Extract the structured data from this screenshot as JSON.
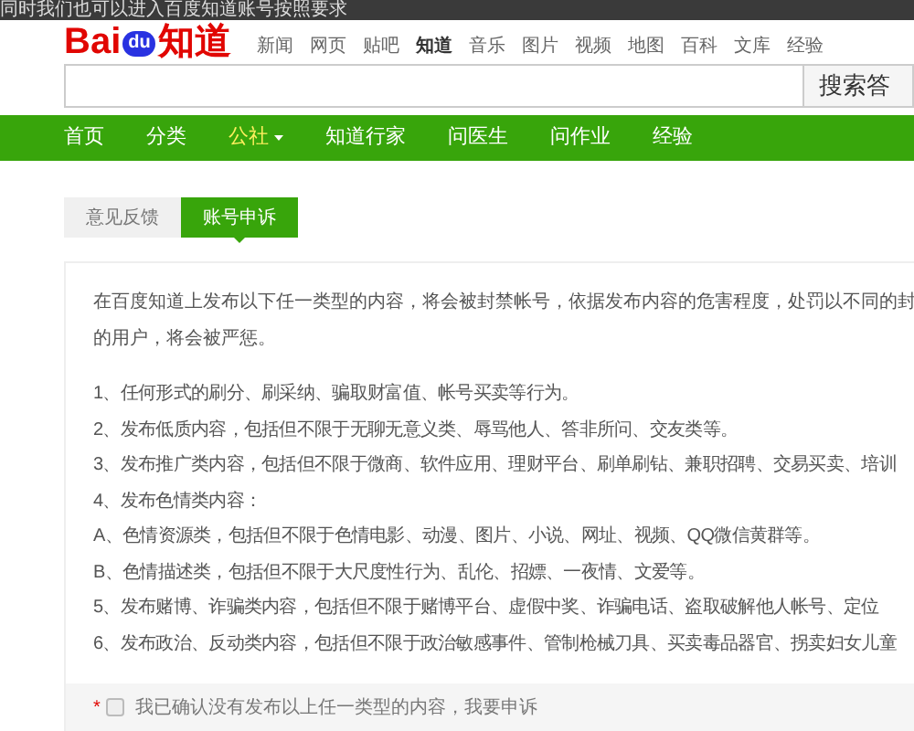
{
  "top_caption": "同时我们也可以进入百度知道账号按照要求",
  "logo": {
    "text_left": "Bai",
    "text_paw": "du",
    "text_right": "知道"
  },
  "product_links": [
    {
      "label": "新闻",
      "selected": false
    },
    {
      "label": "网页",
      "selected": false
    },
    {
      "label": "贴吧",
      "selected": false
    },
    {
      "label": "知道",
      "selected": true
    },
    {
      "label": "音乐",
      "selected": false
    },
    {
      "label": "图片",
      "selected": false
    },
    {
      "label": "视频",
      "selected": false
    },
    {
      "label": "地图",
      "selected": false
    },
    {
      "label": "百科",
      "selected": false
    },
    {
      "label": "文库",
      "selected": false
    },
    {
      "label": "经验",
      "selected": false
    }
  ],
  "search": {
    "button": "搜索答"
  },
  "nav": [
    {
      "label": "首页",
      "selected": false,
      "dropdown": false
    },
    {
      "label": "分类",
      "selected": false,
      "dropdown": false
    },
    {
      "label": "公社",
      "selected": true,
      "dropdown": true
    },
    {
      "label": "知道行家",
      "selected": false,
      "dropdown": false
    },
    {
      "label": "问医生",
      "selected": false,
      "dropdown": false
    },
    {
      "label": "问作业",
      "selected": false,
      "dropdown": false
    },
    {
      "label": "经验",
      "selected": false,
      "dropdown": false
    }
  ],
  "tabs": [
    {
      "label": "意见反馈",
      "selected": false
    },
    {
      "label": "账号申诉",
      "selected": true
    }
  ],
  "intro": [
    "在百度知道上发布以下任一类型的内容，将会被封禁帐号，依据发布内容的危害程度，处罚以不同的封",
    "的用户，将会被严惩。"
  ],
  "rules": [
    "1、任何形式的刷分、刷采纳、骗取财富值、帐号买卖等行为。",
    "2、发布低质内容，包括但不限于无聊无意义类、辱骂他人、答非所问、交友类等。",
    "3、发布推广类内容，包括但不限于微商、软件应用、理财平台、刷单刷钻、兼职招聘、交易买卖、培训",
    "4、发布色情类内容：",
    "A、色情资源类，包括但不限于色情电影、动漫、图片、小说、网址、视频、QQ微信黄群等。",
    "B、色情描述类，包括但不限于大尺度性行为、乱伦、招嫖、一夜情、文爱等。",
    "5、发布赌博、诈骗类内容，包括但不限于赌博平台、虚假中奖、诈骗电话、盗取破解他人帐号、定位",
    "6、发布政治、反动类内容，包括但不限于政治敏感事件、管制枪械刀具、买卖毒品器官、拐卖妇女儿童"
  ],
  "confirm": {
    "required_mark": "*",
    "label": "我已确认没有发布以上任一类型的内容，我要申诉",
    "checked": false
  }
}
